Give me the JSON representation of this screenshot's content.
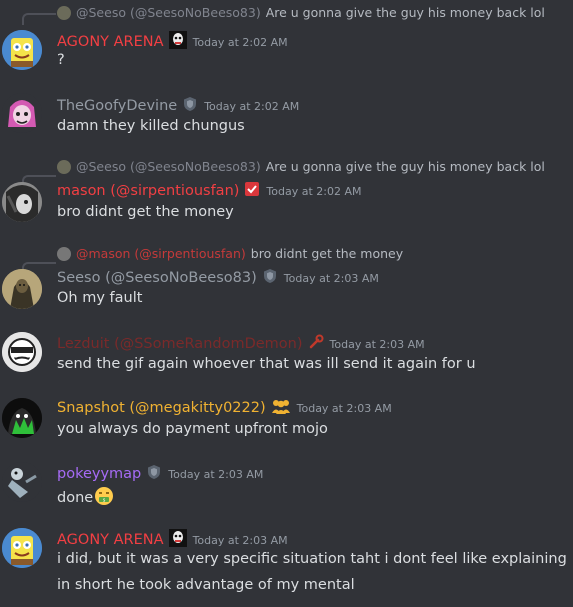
{
  "messages": [
    {
      "reply": {
        "author": "@Seeso (@SeesoNoBeeso83)",
        "text": "Are u gonna give the guy his money back lol"
      },
      "author": "AGONY ARENA",
      "author_color": "#f23f43",
      "timestamp": "Today at 2:02 AM",
      "lines": [
        "?"
      ]
    },
    {
      "author": "TheGoofyDevine",
      "author_color": "#949ba4",
      "timestamp": "Today at 2:02 AM",
      "lines": [
        "damn they killed chungus"
      ]
    },
    {
      "reply": {
        "author": "@Seeso (@SeesoNoBeeso83)",
        "text": "Are u gonna give the guy his money back lol"
      },
      "author": "mason (@sirpentiousfan)",
      "author_color": "#f23f43",
      "timestamp": "Today at 2:02 AM",
      "lines": [
        "bro didnt get the money"
      ]
    },
    {
      "reply": {
        "author": "@mason (@sirpentiousfan)",
        "author_color": "#c43a3a",
        "text": "bro didnt get the money"
      },
      "author": "Seeso (@SeesoNoBeeso83)",
      "author_color": "#949ba4",
      "timestamp": "Today at 2:03 AM",
      "lines": [
        "Oh my fault"
      ]
    },
    {
      "author": "Lezduit (@SSomeRandomDemon)",
      "author_color": "#7a2a2a",
      "timestamp": "Today at 2:03 AM",
      "lines": [
        "send the gif again whoever that was ill send it again for u"
      ]
    },
    {
      "author": "Snapshot (@megakitty0222)",
      "author_color": "#f0b232",
      "timestamp": "Today at 2:03 AM",
      "lines": [
        "you always do payment upfront mojo"
      ]
    },
    {
      "author": "pokeyymap",
      "author_color": "#a66bf5",
      "timestamp": "Today at 2:03 AM",
      "lines": [
        "done"
      ]
    },
    {
      "author": "AGONY ARENA",
      "author_color": "#f23f43",
      "timestamp": "Today at 2:03 AM",
      "lines": [
        "i did, but it was a very specific situation taht i dont feel like explaining",
        "in short he took advantage of my mental"
      ]
    }
  ],
  "colors": {
    "background": "#313338",
    "text": "#dbdee1",
    "muted": "#949ba4"
  }
}
